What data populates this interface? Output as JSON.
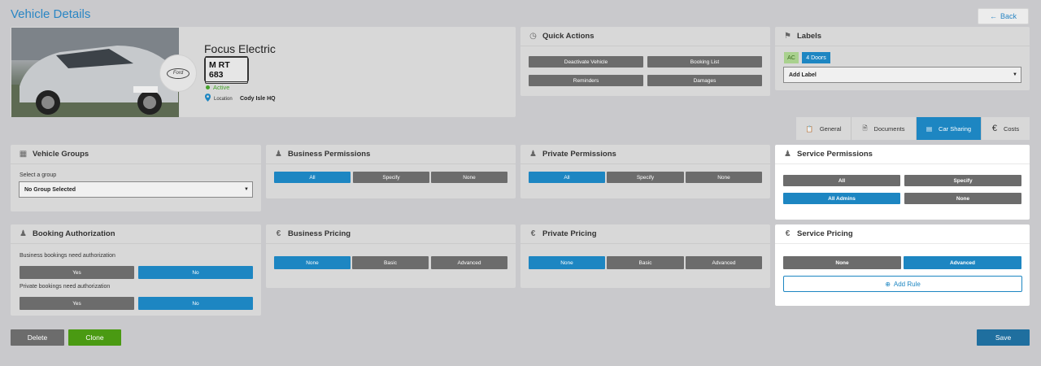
{
  "page": {
    "title": "Vehicle Details",
    "back_label": "Back"
  },
  "vehicle": {
    "name": "Focus Electric",
    "plate": "M RT 683",
    "status": "Active",
    "location_label": "Location",
    "location_value": "Cody Isle HQ",
    "logo_text": "Ford"
  },
  "quick_actions": {
    "title": "Quick Actions",
    "buttons": [
      "Deactivate Vehicle",
      "Booking List",
      "Reminders",
      "Damages"
    ]
  },
  "labels": {
    "title": "Labels",
    "tags": [
      "AC",
      "4 Doors"
    ],
    "add_label": "Add Label"
  },
  "tabs": [
    {
      "label": "General",
      "icon": "clipboard-icon",
      "active": false
    },
    {
      "label": "Documents",
      "icon": "document-icon",
      "active": false
    },
    {
      "label": "Car Sharing",
      "icon": "car-sharing-icon",
      "active": true
    },
    {
      "label": "Costs",
      "icon": "euro-icon",
      "active": false
    }
  ],
  "vehicle_groups": {
    "title": "Vehicle Groups",
    "select_label": "Select a group",
    "selected": "No Group Selected"
  },
  "business_permissions": {
    "title": "Business Permissions",
    "options": [
      "All",
      "Specify",
      "None"
    ],
    "selected": "All"
  },
  "private_permissions": {
    "title": "Private Permissions",
    "options": [
      "All",
      "Specify",
      "None"
    ],
    "selected": "All"
  },
  "service_permissions": {
    "title": "Service Permissions",
    "options": [
      "All",
      "Specify",
      "All Admins",
      "None"
    ],
    "selected": "All Admins"
  },
  "booking_authorization": {
    "title": "Booking Authorization",
    "business_label": "Business bookings need authorization",
    "private_label": "Private bookings need authorization",
    "yes": "Yes",
    "no": "No",
    "business_value": "No",
    "private_value": "No"
  },
  "business_pricing": {
    "title": "Business Pricing",
    "options": [
      "None",
      "Basic",
      "Advanced"
    ],
    "selected": "None"
  },
  "private_pricing": {
    "title": "Private Pricing",
    "options": [
      "None",
      "Basic",
      "Advanced"
    ],
    "selected": "None"
  },
  "service_pricing": {
    "title": "Service Pricing",
    "options": [
      "None",
      "Advanced"
    ],
    "selected": "Advanced",
    "add_rule": "Add Rule"
  },
  "footer": {
    "delete": "Delete",
    "clone": "Clone",
    "save": "Save"
  },
  "colors": {
    "accent": "#1d86c2",
    "success": "#45a32b",
    "clone": "#4a9a12",
    "save": "#1f6f9f",
    "button_gray": "#6c6c6c"
  }
}
